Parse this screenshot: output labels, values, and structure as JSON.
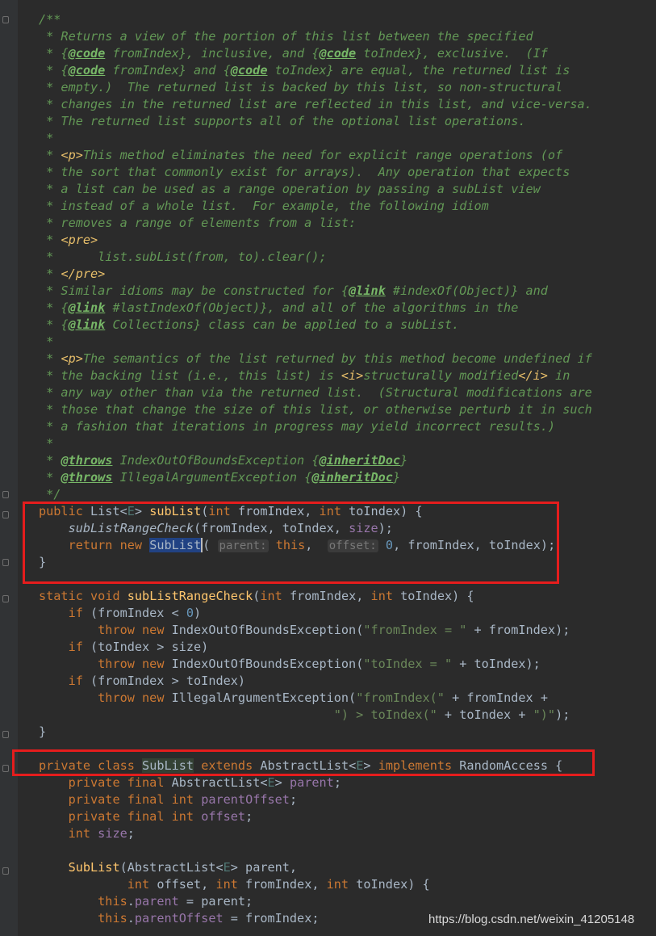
{
  "editor": {
    "doc": {
      "open": "/**",
      "line1": " * Returns a view of the portion of this list between the specified",
      "line2_prefix": " * {",
      "line2_code1": "@code",
      "line2_mid": " fromIndex}, inclusive, and {",
      "line2_code2": "@code",
      "line2_end": " toIndex}, exclusive.  (If",
      "line3_prefix": " * {",
      "line3_code1": "@code",
      "line3_mid": " fromIndex} and {",
      "line3_code2": "@code",
      "line3_end": " toIndex} are equal, the returned list is",
      "line4": " * empty.)  The returned list is backed by this list, so non-structural",
      "line5": " * changes in the returned list are reflected in this list, and vice-versa.",
      "line6": " * The returned list supports all of the optional list operations.",
      "blank": " *",
      "p_prefix": " * ",
      "p_tag": "<p>",
      "line8_text": "This method eliminates the need for explicit range operations (of",
      "line9": " * the sort that commonly exist for arrays).  Any operation that expects",
      "line10": " * a list can be used as a range operation by passing a subList view",
      "line11": " * instead of a whole list.  For example, the following idiom",
      "line12": " * removes a range of elements from a list:",
      "pre_open": "<pre>",
      "pre_line": " *      list.subList(from, to).clear();",
      "pre_close": "</pre>",
      "line16_prefix": " * Similar idioms may be constructed for {",
      "link": "@link",
      "line16_end": " #indexOf(Object)} and",
      "line17_prefix": " * {",
      "line17_end": " #lastIndexOf(Object)}, and all of the algorithms in the",
      "line18_prefix": " * {",
      "line18_end": " Collections} class can be applied to a subList.",
      "line20_text": "The semantics of the list returned by this method become undefined if",
      "line21_a": " * the backing list (i.e., this list) is ",
      "i_open": "<i>",
      "line21_b": "structurally modified",
      "i_close": "</i>",
      "line21_c": " in",
      "line22": " * any way other than via the returned list.  (Structural modifications are",
      "line23": " * those that change the size of this list, or otherwise perturb it in such",
      "line24": " * a fashion that iterations in progress may yield incorrect results.)",
      "throws": "@throws",
      "throws1_exc": " IndexOutOfBoundsException {",
      "inherit": "@inheritDoc",
      "throws_close": "}",
      "throws2_exc": " IllegalArgumentException {",
      "close": " */"
    },
    "code": {
      "kw_public": "public",
      "type_list": " List<",
      "gen_e": "E",
      "gt_space": "> ",
      "fn_sublist": "subList",
      "sig1_rest": "(",
      "kw_int": "int",
      "p_from": " fromIndex, ",
      "p_to": " toIndex) {",
      "call_check": "subListRangeCheck",
      "call_args": "(fromIndex, toIndex, ",
      "fld_size": "size",
      "call_end": ");",
      "kw_return": "return",
      "kw_new": "new",
      "cls_sublist": "SubList",
      "paren_open": "(",
      "hint_parent": "parent:",
      "kw_this": "this",
      "comma": ", ",
      "hint_offset": "offset:",
      "num_zero": "0",
      "ret_end": ", fromIndex, toIndex);",
      "brace_close": "}",
      "kw_static": "static",
      "kw_void": "void",
      "fn_check": "subListRangeCheck",
      "p_size": " size) {",
      "kw_if": "if",
      "cond1": " (fromIndex < ",
      "paren_close": ")",
      "kw_throw": "throw",
      "exc_ioob": " IndexOutOfBoundsException(",
      "str_from": "\"fromIndex = \"",
      "concat_from": " + fromIndex);",
      "cond2": " (toIndex > size)",
      "str_to": "\"toIndex = \"",
      "concat_to": " + toIndex);",
      "cond3": " (fromIndex > toIndex)",
      "exc_iae": " IllegalArgumentException(",
      "str_from_paren": "\"fromIndex(\"",
      "concat_plus": " + fromIndex +",
      "str_to_paren": "\") > toIndex(\"",
      "concat_to_plus": " + toIndex + ",
      "str_close": "\")\"",
      "semi_end": ");",
      "kw_private": "private",
      "kw_class": "class",
      "kw_extends": "extends",
      "cls_abstract": " AbstractList<",
      "kw_implements": "implements",
      "cls_random": " RandomAccess {",
      "kw_final": "final",
      "fld_parent": "parent",
      "fld_parentOffset": "parentOffset",
      "fld_offset": "offset",
      "semi": ";",
      "ctor_name": "SubList",
      "ctor_param1": "(AbstractList<",
      "ctor_param1_end": "> parent,",
      "ctor_offset": " offset, ",
      "ctor_from": " fromIndex, ",
      "ctor_to": " toIndex) {",
      "this_dot": ".",
      "assign_parent": " = parent;",
      "assign_from": " = fromIndex;"
    }
  },
  "watermark": "https://blog.csdn.net/weixin_41205148",
  "colors": {
    "background": "#2b2b2b",
    "keyword": "#cc7832",
    "method": "#ffc66d",
    "field": "#9876aa",
    "string": "#6a8759",
    "number": "#6897bb",
    "javadoc": "#629755",
    "annotation_box": "#e51d1d"
  }
}
